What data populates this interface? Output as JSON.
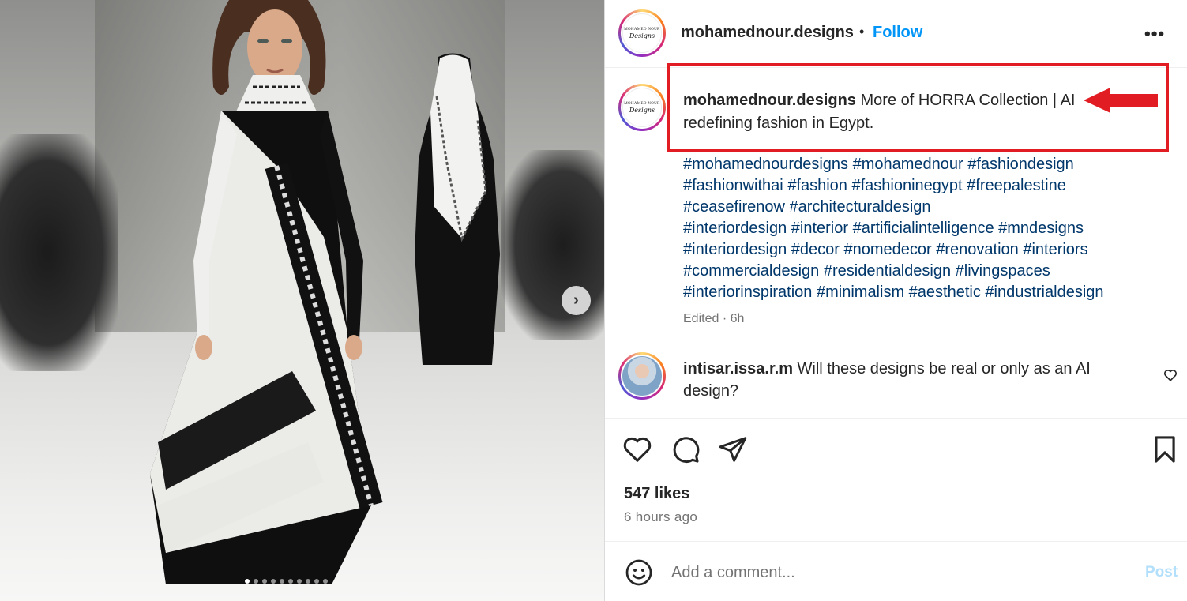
{
  "post": {
    "username": "mohamednour.designs",
    "follow_label": "Follow",
    "separator": "•",
    "more_label": "•••",
    "avatar_logo_top": "MOHAMED NOUR",
    "avatar_logo_script": "Designs"
  },
  "caption": {
    "username": "mohamednour.designs",
    "text": "More of HORRA Collection | AI redefining fashion in Egypt.",
    "hashtags": [
      "#mohamednourdesigns",
      "#mohamednour",
      "#fashiondesign",
      "#fashionwithai",
      "#fashion",
      "#fashioninegypt",
      "#freepalestine",
      "#ceasefirenow",
      "#architecturaldesign",
      "#interiordesign",
      "#interior",
      "#artificialintelligence",
      "#mndesigns",
      "#interiordesign",
      "#decor",
      "#nomedecor",
      "#renovation",
      "#interiors",
      "#commercialdesign",
      "#residentialdesign",
      "#livingspaces",
      "#interiorinspiration",
      "#minimalism",
      "#aesthetic",
      "#industrialdesign"
    ],
    "meta": "Edited · 6h"
  },
  "comment": {
    "username": "intisar.issa.r.m",
    "text": "Will these designs be real or only as an AI design?"
  },
  "stats": {
    "likes": "547 likes",
    "time": "6 hours ago"
  },
  "comment_box": {
    "placeholder": "Add a comment...",
    "post_label": "Post"
  },
  "carousel": {
    "next_label": "›",
    "dot_count": 10,
    "active_index": 0
  },
  "colors": {
    "accent": "#0095f6",
    "hashtag": "#00376b",
    "annotation": "#e21c23"
  },
  "icons": [
    "heart-icon",
    "comment-icon",
    "share-icon",
    "bookmark-icon",
    "emoji-icon",
    "more-icon",
    "chevron-right-icon"
  ]
}
